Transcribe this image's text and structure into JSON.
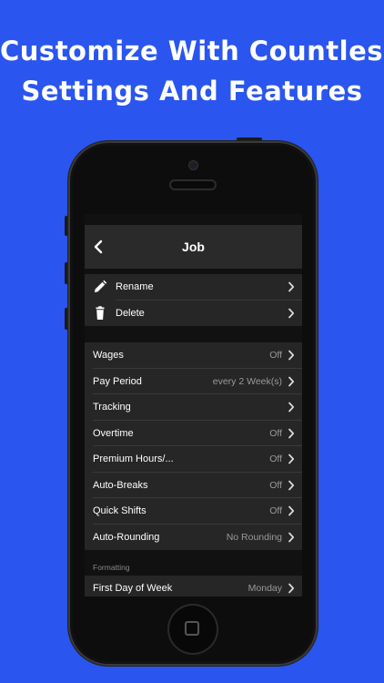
{
  "headline": {
    "line1": "Customize With Countless",
    "line2": "Settings And Features"
  },
  "nav": {
    "title": "Job"
  },
  "actions": [
    {
      "label": "Rename",
      "icon": "pencil-icon"
    },
    {
      "label": "Delete",
      "icon": "trash-icon"
    }
  ],
  "settings": [
    {
      "label": "Wages",
      "value": "Off"
    },
    {
      "label": "Pay Period",
      "value": "every 2 Week(s)"
    },
    {
      "label": "Tracking",
      "value": ""
    },
    {
      "label": "Overtime",
      "value": "Off"
    },
    {
      "label": "Premium Hours/...",
      "value": "Off"
    },
    {
      "label": "Auto-Breaks",
      "value": "Off"
    },
    {
      "label": "Quick Shifts",
      "value": "Off"
    },
    {
      "label": "Auto-Rounding",
      "value": "No Rounding"
    }
  ],
  "formatting": {
    "header": "Formatting",
    "rows": [
      {
        "label": "First Day of Week",
        "value": "Monday"
      }
    ]
  },
  "colors": {
    "background": "#2a55ee",
    "screen": "#111111",
    "cell": "#262626"
  }
}
